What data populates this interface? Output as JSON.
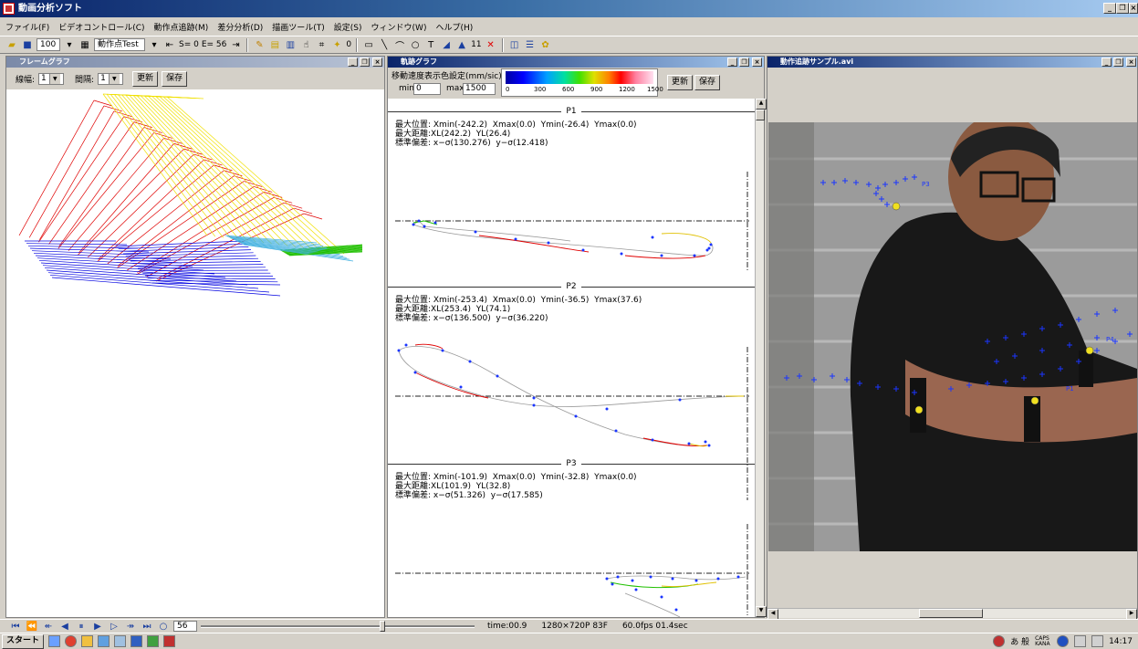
{
  "window": {
    "title": "動画分析ソフト"
  },
  "menu": [
    "ファイル(F)",
    "ビデオコントロール(C)",
    "動作点追跡(M)",
    "差分分析(D)",
    "描画ツール(T)",
    "設定(S)",
    "ウィンドウ(W)",
    "ヘルプ(H)"
  ],
  "toolbar": {
    "zoom": "100",
    "mode": "動作点Test",
    "s_value": "S= 0",
    "e_value": "E= 56",
    "point_num": "0",
    "font_size": "11"
  },
  "frame_pane": {
    "title": "フレームグラフ",
    "line_width_label": "線幅:",
    "line_width_value": "1",
    "interval_label": "間隔:",
    "interval_value": "1",
    "update_label": "更新",
    "save_label": "保存"
  },
  "trajectory_pane": {
    "title": "軌跡グラフ",
    "speed_label": "移動速度表示色設定(mm/sic)",
    "min_label": "min",
    "min_value": "0",
    "max_label": "max",
    "max_value": "1500",
    "scale_ticks": [
      "0",
      "300",
      "600",
      "900",
      "1200",
      "1500"
    ],
    "update_label": "更新",
    "save_label": "保存",
    "sections": [
      {
        "name": "P1",
        "line1": "最大位置: Xmin(-242.2)  Xmax(0.0)  Ymin(-26.4)  Ymax(0.0)",
        "line2": "最大距離:XL(242.2)  YL(26.4)",
        "line3": "標準偏差: x−σ(130.276)  y−σ(12.418)"
      },
      {
        "name": "P2",
        "line1": "最大位置: Xmin(-253.4)  Xmax(0.0)  Ymin(-36.5)  Ymax(37.6)",
        "line2": "最大距離:XL(253.4)  YL(74.1)",
        "line3": "標準偏差: x−σ(136.500)  y−σ(36.220)"
      },
      {
        "name": "P3",
        "line1": "最大位置: Xmin(-101.9)  Xmax(0.0)  Ymin(-32.8)  Ymax(0.0)",
        "line2": "最大距離:XL(101.9)  YL(32.8)",
        "line3": "標準偏差: x−σ(51.326)  y−σ(17.585)"
      }
    ]
  },
  "video_pane": {
    "title": "動作追跡サンプル.avi",
    "labels": [
      "P3",
      "P4",
      "P1"
    ]
  },
  "playback": {
    "frame": "56",
    "time": "time:00.9",
    "resolution": "1280×720P  83F",
    "fps": "60.0fps  01.4sec"
  },
  "taskbar": {
    "start_label": "スタート",
    "ime": "あ 般",
    "caps": "CAPS KANA",
    "clock": "14:17"
  },
  "colors": {
    "title_start": "#0a246a",
    "title_end": "#a6caf0",
    "frame_red": "#e00000",
    "frame_yellow": "#f0e000",
    "frame_blue": "#0000e0",
    "marker_blue": "#1a35ff"
  }
}
